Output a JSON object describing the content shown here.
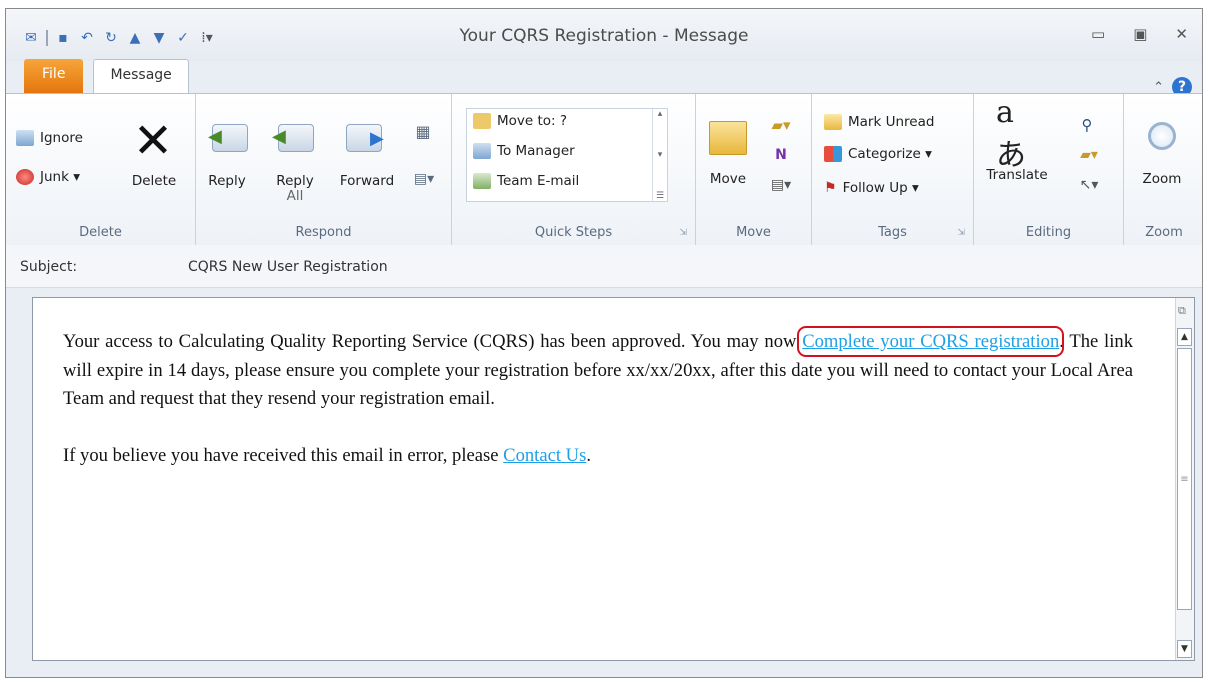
{
  "window": {
    "title": "Your CQRS Registration - Message"
  },
  "tabs": {
    "file": "File",
    "message": "Message"
  },
  "ribbon": {
    "delete": {
      "ignore": "Ignore",
      "junk": "Junk ▾",
      "delete": "Delete",
      "label": "Delete"
    },
    "respond": {
      "reply": "Reply",
      "reply_all_1": "Reply",
      "reply_all_2": "All",
      "forward": "Forward",
      "label": "Respond"
    },
    "quick_steps": {
      "items": [
        "Move to: ?",
        "To Manager",
        "Team E-mail"
      ],
      "label": "Quick Steps"
    },
    "move": {
      "move": "Move",
      "label": "Move"
    },
    "tags": {
      "mark_unread": "Mark Unread",
      "categorize": "Categorize ▾",
      "follow_up": "Follow Up ▾",
      "label": "Tags"
    },
    "editing": {
      "translate": "Translate",
      "label": "Editing"
    },
    "zoom": {
      "zoom": "Zoom",
      "label": "Zoom"
    }
  },
  "subject": {
    "label": "Subject:",
    "value": "CQRS New User Registration"
  },
  "body": {
    "p1_before": "Your access to Calculating Quality Reporting Service (CQRS) has been approved.  You may now ",
    "p1_link": "Complete your CQRS registration",
    "p1_after": ". The link will expire in 14 days, please ensure you complete your registration before xx/xx/20xx, after this date you will need to contact your Local Area Team and request that they resend your registration email.",
    "p2_before": "If you believe you have received this email in error, please ",
    "p2_link": "Contact Us",
    "p2_after": "."
  },
  "colors": {
    "link": "#1ea0e6",
    "highlight": "#d0131e",
    "file_tab": "#e3760d"
  }
}
